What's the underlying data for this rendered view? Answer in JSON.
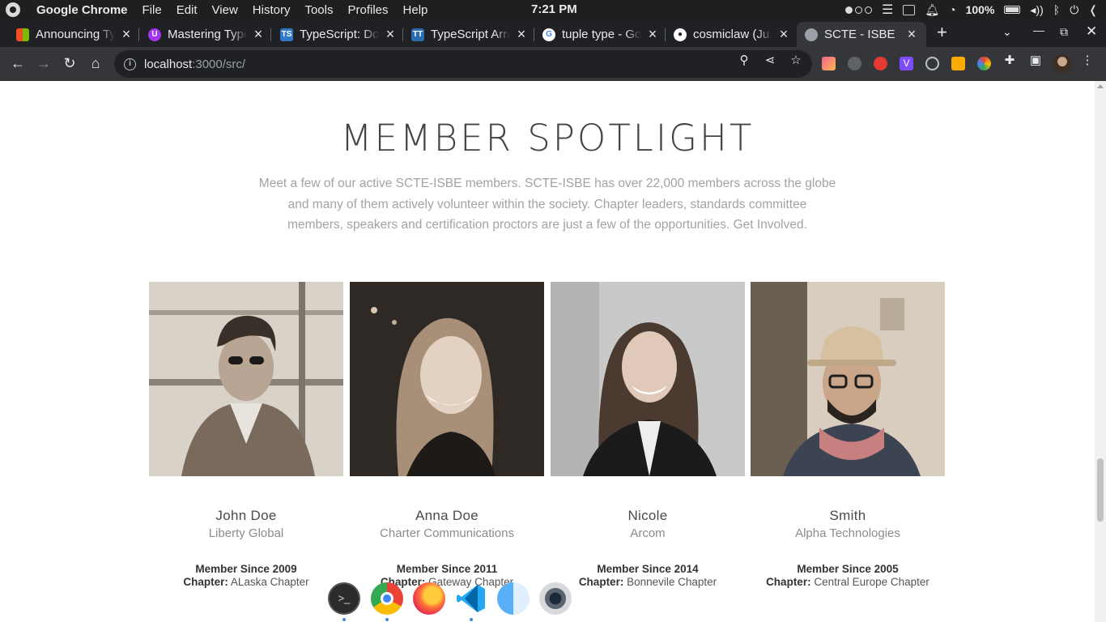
{
  "menubar": {
    "app_name": "Google Chrome",
    "menus": [
      "File",
      "Edit",
      "View",
      "History",
      "Tools",
      "Profiles",
      "Help"
    ],
    "clock": "7:21 PM",
    "battery": "100%"
  },
  "tabs": [
    {
      "title": "Announcing TypeScript",
      "favicon": "microsoft-logo"
    },
    {
      "title": "Mastering TypeScript",
      "favicon": "udemy-logo"
    },
    {
      "title": "TypeScript: Documentation",
      "favicon": "ts-logo"
    },
    {
      "title": "TypeScript Arrays",
      "favicon": "tt-logo"
    },
    {
      "title": "tuple type - Google",
      "favicon": "google-logo"
    },
    {
      "title": "cosmiclaw (Ju",
      "favicon": "github-logo"
    },
    {
      "title": "SCTE - ISBE",
      "favicon": "globe",
      "active": true
    }
  ],
  "toolbar": {
    "url_host": "localhost",
    "url_rest": ":3000/src/"
  },
  "section": {
    "title": "MEMBER SPOTLIGHT",
    "intro_lines": [
      "Meet a few of our active SCTE-ISBE members. SCTE-ISBE has over 22,000 members across the globe",
      "and many of them actively volunteer within the society. Chapter leaders, standards committee",
      "members, speakers and certification proctors are just a few of the opportunities. Get Involved."
    ]
  },
  "members": [
    {
      "name": "John Doe",
      "company": "Liberty Global",
      "since": "Member Since 2009",
      "chapter_label": "Chapter:",
      "chapter": "ALaska Chapter"
    },
    {
      "name": "Anna Doe",
      "company": "Charter Communications",
      "since": "Member Since 2011",
      "chapter_label": "Chapter:",
      "chapter": "Gateway Chapter"
    },
    {
      "name": "Nicole",
      "company": "Arcom",
      "since": "Member Since 2014",
      "chapter_label": "Chapter:",
      "chapter": "Bonnevile Chapter"
    },
    {
      "name": "Smith",
      "company": "Alpha Technologies",
      "since": "Member Since 2005",
      "chapter_label": "Chapter:",
      "chapter": "Central Europe Chapter"
    }
  ],
  "dock": [
    "terminal-icon",
    "chrome-icon",
    "firefox-icon",
    "vscode-icon",
    "finder-icon",
    "camera-icon"
  ]
}
